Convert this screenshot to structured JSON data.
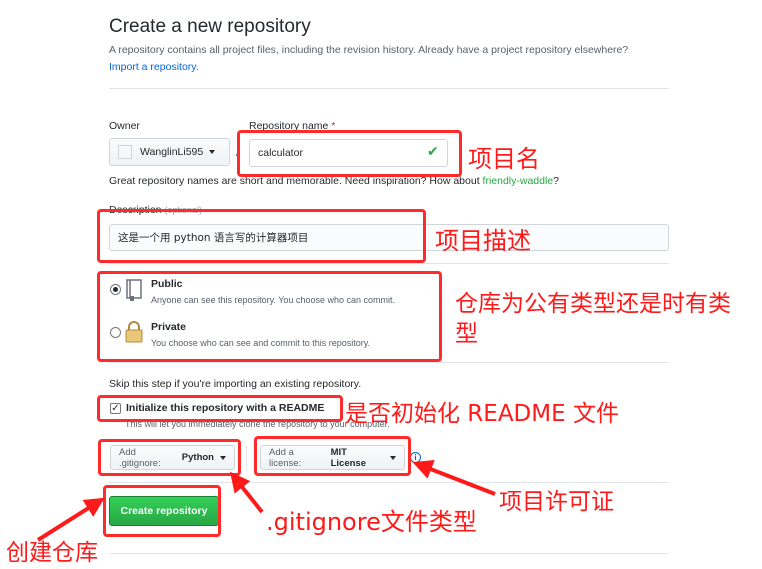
{
  "header": {
    "title": "Create a new repository",
    "subtitle": "A repository contains all project files, including the revision history. Already have a project repository elsewhere?",
    "import_link": "Import a repository."
  },
  "form": {
    "owner_label": "Owner",
    "owner_value": "WanglinLi595",
    "separator": "/",
    "repo_label": "Repository name",
    "required_mark": "*",
    "repo_value": "calculator",
    "hint_text": "Great repository names are short and memorable. Need inspiration? How about",
    "hint_suggestion": "friendly-waddle",
    "hint_end": "?",
    "description_label": "Description",
    "description_optional": "(optional)",
    "description_value": "这是一个用 python 语言写的计算器项目",
    "visibility": [
      {
        "title": "Public",
        "desc": "Anyone can see this repository. You choose who can commit.",
        "selected": true,
        "icon": "book-icon"
      },
      {
        "title": "Private",
        "desc": "You choose who can see and commit to this repository.",
        "selected": false,
        "icon": "lock-icon"
      }
    ],
    "skip_text": "Skip this step if you're importing an existing repository.",
    "init_label": "Initialize this repository with a README",
    "init_checked": true,
    "init_desc": "This will let you immediately clone the repository to your computer.",
    "gitignore_label": "Add .gitignore:",
    "gitignore_value": "Python",
    "license_label": "Add a license:",
    "license_value": "MIT License",
    "info_icon": "i",
    "submit_label": "Create repository"
  },
  "annotations": {
    "repo_name": "项目名",
    "description": "项目描述",
    "visibility": "仓库为公有类型还是时有类型",
    "readme": "是否初始化 README 文件",
    "license": "项目许可证",
    "gitignore": ".gitignore文件类型",
    "create": "创建仓库"
  },
  "colors": {
    "annotation_red": "#ff1a1a",
    "primary_green": "#28a745",
    "link_blue": "#0366d6"
  }
}
